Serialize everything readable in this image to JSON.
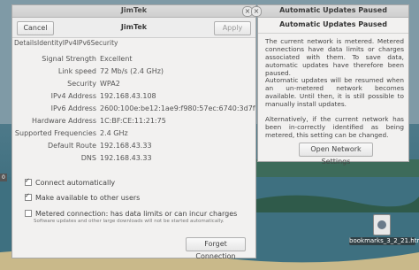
{
  "network_window": {
    "window_title": "JimTek",
    "header_title": "JimTek",
    "cancel_label": "Cancel",
    "apply_label": "Apply",
    "tabs": [
      "Details",
      "Identity",
      "IPv4",
      "IPv6",
      "Security"
    ],
    "details": [
      {
        "label": "Signal Strength",
        "value": "Excellent"
      },
      {
        "label": "Link speed",
        "value": "72 Mb/s (2.4 GHz)"
      },
      {
        "label": "Security",
        "value": "WPA2"
      },
      {
        "label": "IPv4 Address",
        "value": "192.168.43.108"
      },
      {
        "label": "IPv6 Address",
        "value": "2600:100e:be12:1ae9:f980:57ec:6740:3d7f"
      },
      {
        "label": "Hardware Address",
        "value": "1C:BF:CE:11:21:75"
      },
      {
        "label": "Supported Frequencies",
        "value": "2.4 GHz"
      },
      {
        "label": "Default Route",
        "value": "192.168.43.33"
      },
      {
        "label": "DNS",
        "value": "192.168.43.33"
      }
    ],
    "connect_automatically": {
      "label": "Connect automatically",
      "checked": true
    },
    "make_available": {
      "label": "Make available to other users",
      "checked": true
    },
    "metered": {
      "label": "Metered connection: has data limits or can incur charges",
      "sublabel": "Software updates and other large downloads will not be started automatically.",
      "checked": false
    },
    "forget_label": "Forget Connection"
  },
  "notification": {
    "window_title": "Automatic Updates Paused",
    "heading": "Automatic Updates Paused",
    "paragraphs": [
      "The current network is metered. Metered connections have data limits or charges associated with them. To save data, automatic updates have therefore been paused.",
      "Automatic updates will be resumed when an un-metered network becomes available. Until then, it is still possible to manually install updates.",
      "Alternatively, if the current network has been in-correctly identified as being metered, this setting can be changed."
    ],
    "button_label": "Open Network Settings"
  },
  "desktop": {
    "file_label": "bookmarks_3_2_21.html",
    "side_label": "0"
  }
}
